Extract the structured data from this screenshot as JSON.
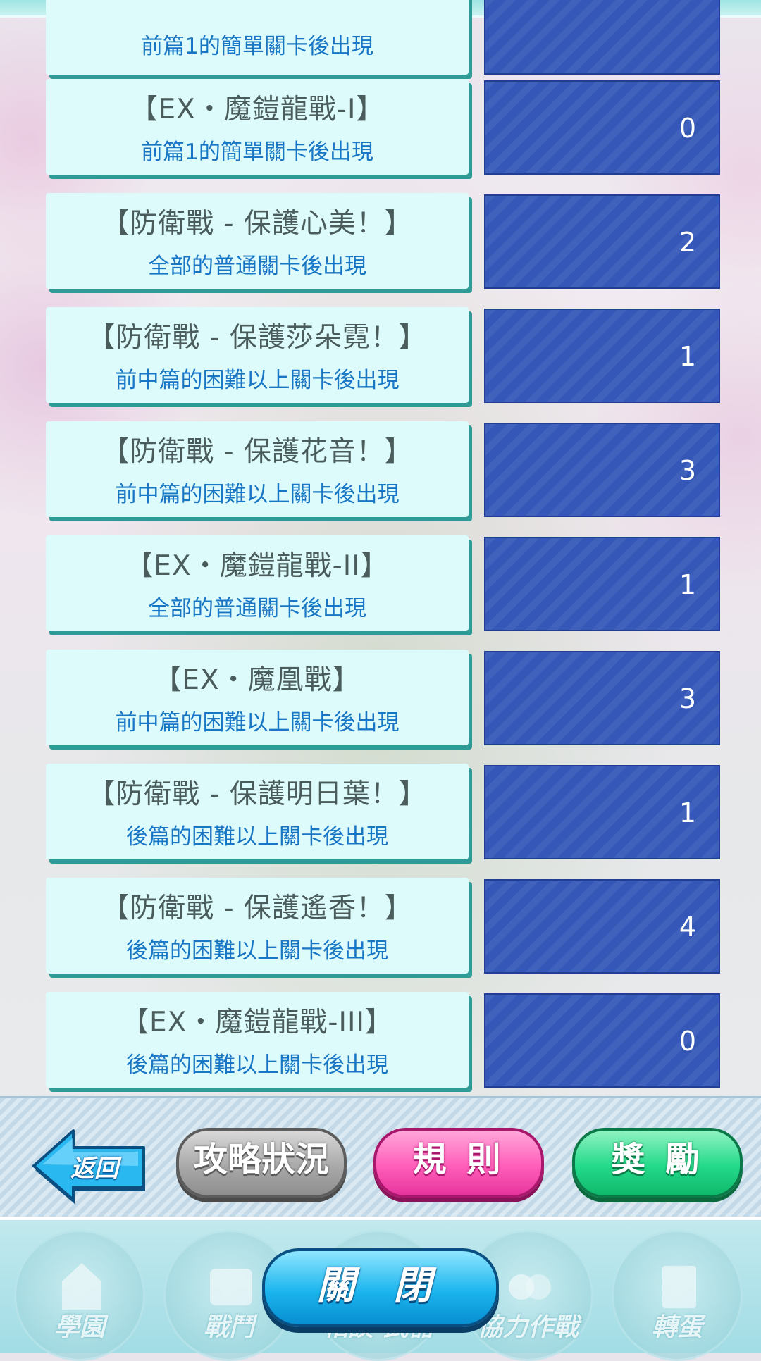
{
  "missions": [
    {
      "title": "",
      "condition": "前篇1的簡單關卡後出現",
      "score": ""
    },
    {
      "title": "【EX・魔鎧龍戰-I】",
      "condition": "前篇1的簡單關卡後出現",
      "score": "0"
    },
    {
      "title": "【防衛戰 - 保護心美！】",
      "condition": "全部的普通關卡後出現",
      "score": "2"
    },
    {
      "title": "【防衛戰 - 保護莎朵霓！】",
      "condition": "前中篇的困難以上關卡後出現",
      "score": "1"
    },
    {
      "title": "【防衛戰 - 保護花音！】",
      "condition": "前中篇的困難以上關卡後出現",
      "score": "3"
    },
    {
      "title": "【EX・魔鎧龍戰-II】",
      "condition": "全部的普通關卡後出現",
      "score": "1"
    },
    {
      "title": "【EX・魔凰戰】",
      "condition": "前中篇的困難以上關卡後出現",
      "score": "3"
    },
    {
      "title": "【防衛戰 - 保護明日葉！】",
      "condition": "後篇的困難以上關卡後出現",
      "score": "1"
    },
    {
      "title": "【防衛戰 - 保護遙香！】",
      "condition": "後篇的困難以上關卡後出現",
      "score": "4"
    },
    {
      "title": "【EX・魔鎧龍戰-III】",
      "condition": "後篇的困難以上關卡後出現",
      "score": "0"
    }
  ],
  "buttons": {
    "back": "返回",
    "progress": "攻略狀況",
    "rules": "規 則",
    "rewards": "獎 勵",
    "close": "關 閉"
  },
  "nav": [
    {
      "label": "學園",
      "icon": "school-icon"
    },
    {
      "label": "戰鬥",
      "icon": "battle-icon"
    },
    {
      "label": "相談·武器",
      "icon": "weapon-icon"
    },
    {
      "label": "協力作戰",
      "icon": "coop-icon"
    },
    {
      "label": "轉蛋",
      "icon": "gacha-icon"
    }
  ],
  "colors": {
    "card_bg": "#ddfbfb",
    "card_shadow": "#2f9b97",
    "score_bg": "#3457b8",
    "condition_text": "#1876c4",
    "rules_pink": "#ff5eb9",
    "rewards_green": "#23d98a",
    "close_blue": "#1cb5ee"
  }
}
